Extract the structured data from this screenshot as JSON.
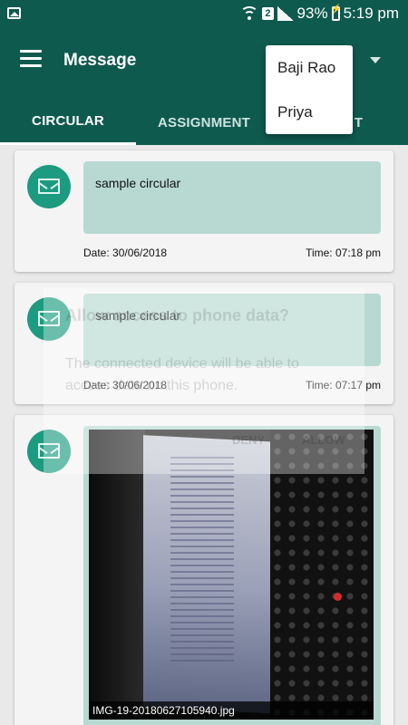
{
  "status_bar": {
    "sim_badge": "2",
    "battery": "93%",
    "time": "5:19 pm",
    "icons": [
      "gallery-icon",
      "wifi-icon",
      "signal-icon",
      "battery-charging-icon"
    ]
  },
  "app_bar": {
    "title": "Message",
    "menu_icon": "hamburger-menu-icon",
    "dropdown_icon": "chevron-down-icon"
  },
  "tabs": [
    {
      "label": "CIRCULAR",
      "active": true
    },
    {
      "label": "ASSIGNMENT",
      "active": false
    },
    {
      "label": "T",
      "active": false
    }
  ],
  "student_menu": {
    "options": [
      "Baji  Rao",
      "Priya"
    ]
  },
  "messages": [
    {
      "text": "sample circular",
      "date": "Date: 30/06/2018",
      "time": "Time: 07:18 pm",
      "icon": "envelope-icon"
    },
    {
      "text": "sample circular",
      "date": "Date: 30/06/2018",
      "time": "Time: 07:17 pm",
      "icon": "envelope-icon"
    },
    {
      "attachment_caption": "IMG-19-20180627105940.jpg",
      "icon": "envelope-icon"
    }
  ],
  "background_dialog": {
    "title": "Allow access to phone data?",
    "body": "The connected device will be able to access data on this phone.",
    "deny": "DENY",
    "allow": "ALLOW"
  },
  "colors": {
    "primary": "#0f5a4f",
    "accent": "#1c9b80",
    "bubble": "#b7d9d2"
  }
}
